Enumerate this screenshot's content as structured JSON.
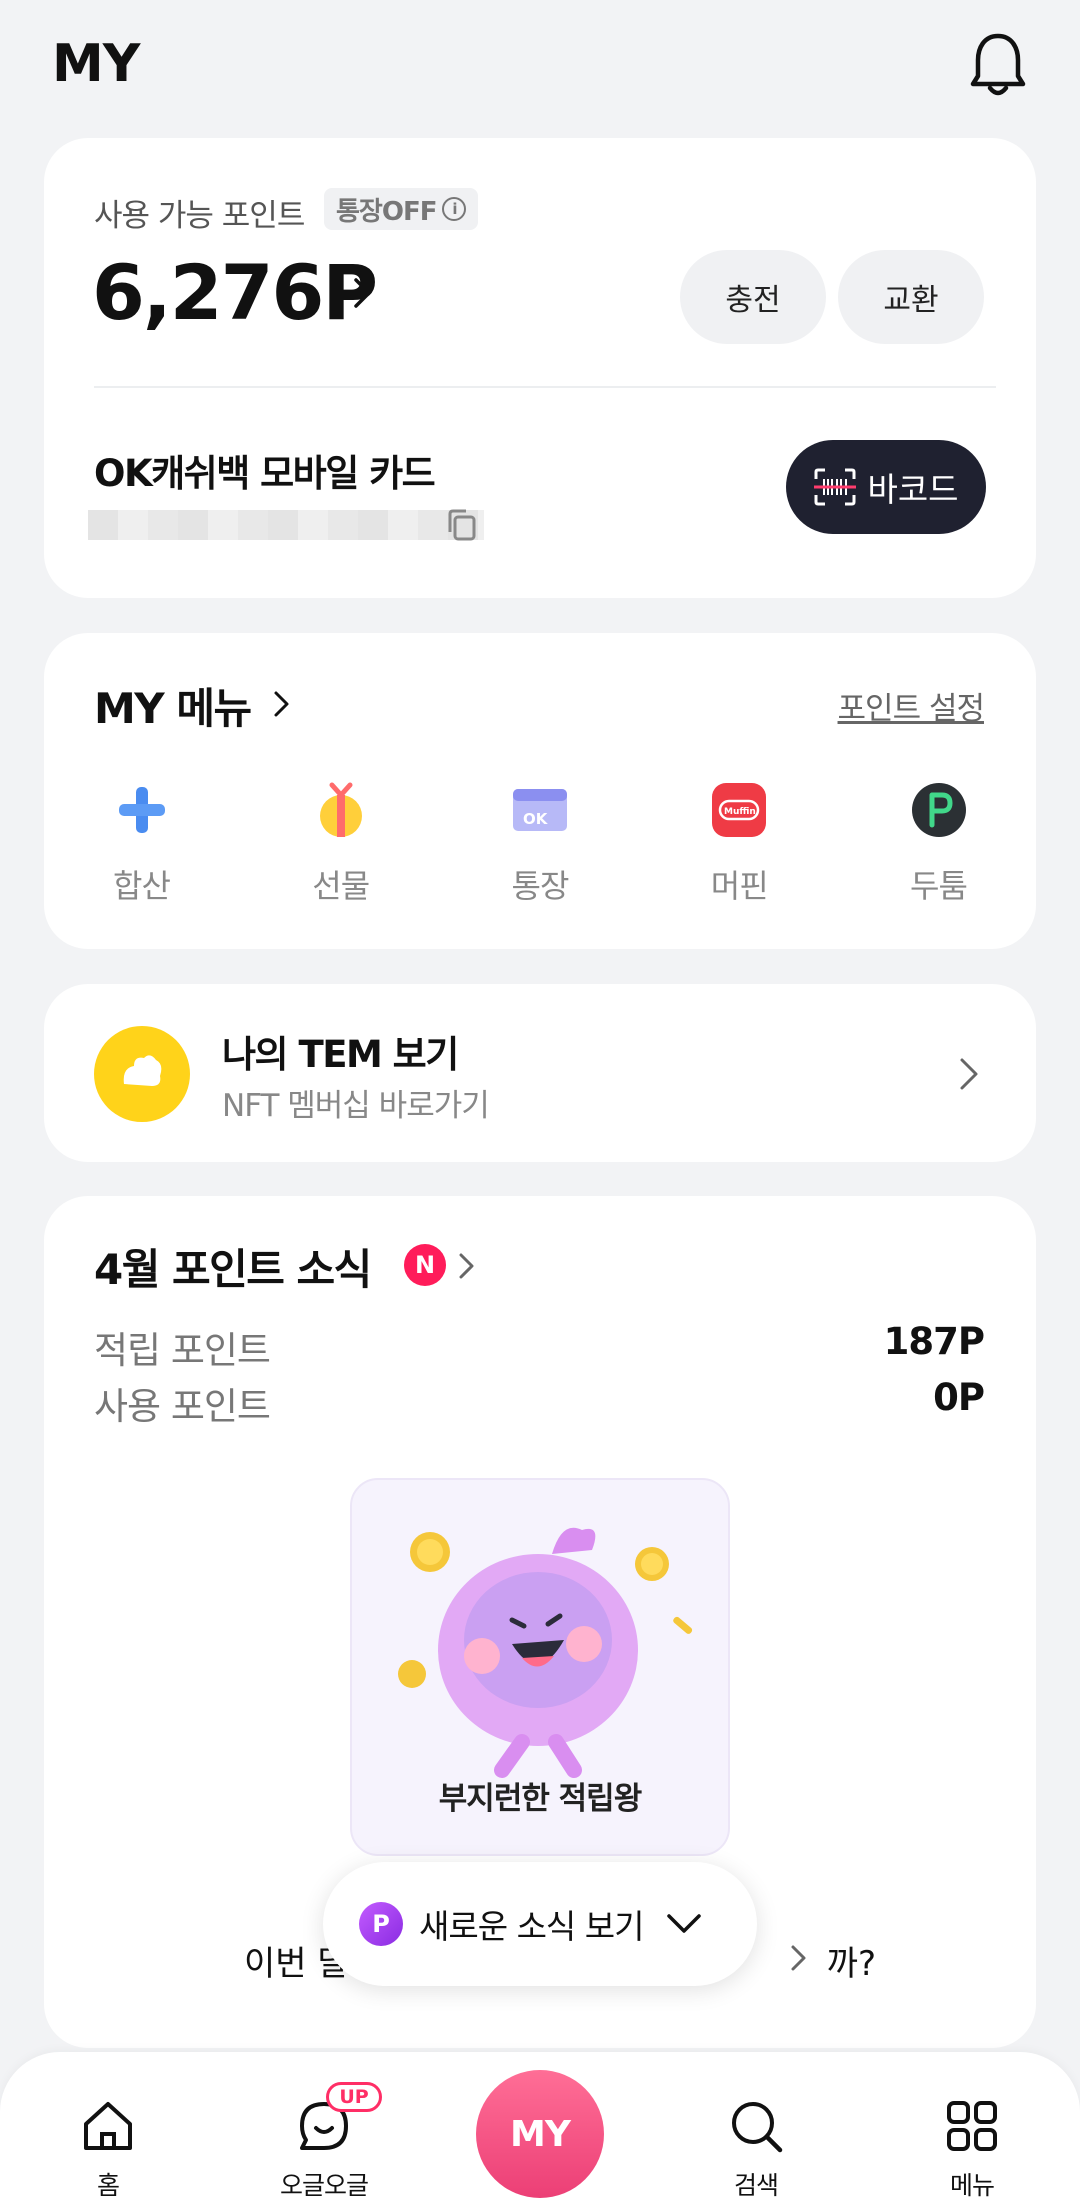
{
  "header": {
    "title": "MY",
    "bell_icon": "bell-icon"
  },
  "points_card": {
    "label": "사용 가능 포인트",
    "badge": "통장OFF",
    "value": "6,276P",
    "charge_label": "충전",
    "exchange_label": "교환",
    "card_title": "OK캐쉬백 모바일 카드",
    "barcode_label": "바코드"
  },
  "my_menu": {
    "title": "MY 메뉴",
    "setting_link": "포인트 설정",
    "items": [
      {
        "label": "합산",
        "icon": "plus-icon"
      },
      {
        "label": "선물",
        "icon": "gift-icon"
      },
      {
        "label": "통장",
        "icon": "bankbook-icon"
      },
      {
        "label": "머핀",
        "icon": "muffin-icon"
      },
      {
        "label": "두툼",
        "icon": "dootoom-icon"
      }
    ]
  },
  "tem": {
    "title": "나의 TEM 보기",
    "subtitle": "NFT 멤버십 바로가기"
  },
  "news": {
    "title": "4월 포인트 소식",
    "badge": "N",
    "earned_label": "적립 포인트",
    "earned_value": "187P",
    "used_label": "사용 포인트",
    "used_value": "0P",
    "badge_caption": "부지런한 적립왕",
    "bottom_text_start": "이번 달",
    "bottom_text_end": "까?"
  },
  "popup": {
    "badge": "P",
    "label": "새로운 소식 보기"
  },
  "bottom_nav": {
    "home": "홈",
    "ogeul": "오글오글",
    "ogeul_badge": "UP",
    "my": "MY",
    "search": "검색",
    "menu": "메뉴"
  },
  "colors": {
    "accent": "#ec3f76",
    "dark_button": "#1f2130",
    "badge_red": "#ff1c5a",
    "tem_yellow": "#ffd31a"
  }
}
